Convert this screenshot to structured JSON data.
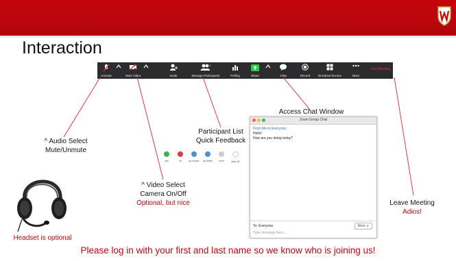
{
  "slide": {
    "title": "Interaction",
    "accent": "#c5050c"
  },
  "toolbar": {
    "items": [
      {
        "label": "Unmute",
        "icon": "muted-microphone-icon"
      },
      {
        "label": "Start Video",
        "icon": "video-off-icon"
      },
      {
        "label": "Invite",
        "icon": "invite-icon"
      },
      {
        "label": "Manage Participants",
        "icon": "participants-icon",
        "count": "1"
      },
      {
        "label": "Polling",
        "icon": "polling-icon"
      },
      {
        "label": "Share",
        "icon": "share-screen-icon"
      },
      {
        "label": "Chat",
        "icon": "chat-icon"
      },
      {
        "label": "Record",
        "icon": "record-icon"
      },
      {
        "label": "Breakout Rooms",
        "icon": "breakout-rooms-icon"
      },
      {
        "label": "More",
        "icon": "more-icon"
      }
    ],
    "end_meeting": "End Meeting"
  },
  "callouts": {
    "audio": {
      "line1": "^ Audio Select",
      "line2": "Mute/Unmute"
    },
    "participants": {
      "line1": "Participant List",
      "line2": "Quick Feedback"
    },
    "video": {
      "line1": "^ Video Select",
      "line2": "Camera On/Off",
      "note": "Optional, but nice"
    },
    "chat": {
      "line1": "Access Chat Window"
    },
    "leave": {
      "line1": "Leave Meeting",
      "note": "Adios!"
    },
    "headset_note": "Headset is optional"
  },
  "feedback": [
    {
      "label": "yes",
      "color": "#3ab54a"
    },
    {
      "label": "no",
      "color": "#e0393e"
    },
    {
      "label": "go slower",
      "color": "#4a90d9"
    },
    {
      "label": "go faster",
      "color": "#4a90d9"
    },
    {
      "label": "more",
      "color": "#cccccc"
    },
    {
      "label": "clear all",
      "color": "#cccccc"
    }
  ],
  "chat": {
    "window_title": "Zoom Group Chat",
    "from": "From Me to Everyone:",
    "messages": [
      "Hello!",
      "How are you doing today?"
    ],
    "to": "To: Everyone",
    "more": "More ∨",
    "input_placeholder": "Type message here..."
  },
  "bottom_note": "Please log in with your first and last name so we know who is joining us!"
}
